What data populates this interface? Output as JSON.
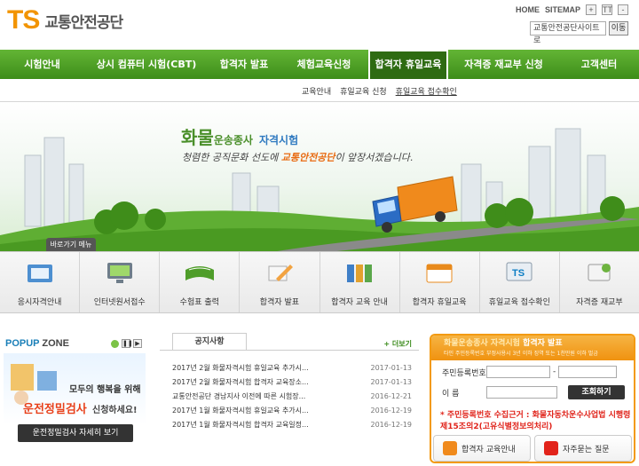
{
  "header": {
    "logo_mark": "TS",
    "logo_name": "교통안전공단",
    "links": [
      "HOME",
      "SITEMAP"
    ],
    "zoom_in": "+",
    "zoom_out": "-",
    "text_size": "TT",
    "site_select": "교통안전공단사이트로",
    "site_go": "이동"
  },
  "nav": {
    "items": [
      {
        "label": "시험안내"
      },
      {
        "label": "상시 컴퓨터 시험(CBT)"
      },
      {
        "label": "합격자 발표"
      },
      {
        "label": "체험교육신청"
      },
      {
        "label": "합격자 휴일교육",
        "active": true
      },
      {
        "label": "자격증 재교부 신청"
      },
      {
        "label": "고객센터"
      }
    ],
    "sub_items": [
      "교육안내",
      "휴일교육 신청",
      "휴일교육 접수확인"
    ]
  },
  "banner": {
    "title_big": "화물",
    "title_small": "운송종사",
    "title_tail": "자격시험",
    "sub_pre": "청렴한 공직문화 선도에",
    "sub_brand": "교통안전공단",
    "sub_post": "이 앞장서겠습니다."
  },
  "quick": {
    "tab": "바로가기 메뉴",
    "items": [
      {
        "label": "응시자격안내",
        "icon": "book-icon"
      },
      {
        "label": "인터넷원서접수",
        "icon": "computer-icon"
      },
      {
        "label": "수험표 출력",
        "icon": "open-book-icon"
      },
      {
        "label": "합격자 발표",
        "icon": "pencil-icon"
      },
      {
        "label": "합격자 교육 안내",
        "icon": "binders-icon"
      },
      {
        "label": "합격자 휴일교육",
        "icon": "calendar-icon"
      },
      {
        "label": "휴일교육 접수확인",
        "icon": "ts-monitor-icon"
      },
      {
        "label": "자격증 재교부",
        "icon": "card-icon"
      }
    ]
  },
  "popup": {
    "title_a": "POPUP",
    "title_b": "ZONE",
    "text1": "모두의 행복을 위해",
    "text2": "운전정밀검사",
    "text3": "신청하세요!",
    "button": "운전정밀검사 자세히 보기"
  },
  "notice": {
    "tab": "공지사항",
    "more": "+ 더보기",
    "rows": [
      {
        "title": "2017년 2월 화물자격시험 휴일교육 추가시...",
        "date": "2017-01-13"
      },
      {
        "title": "2017년 2월 화물자격시험 합격자 교육장소...",
        "date": "2017-01-13"
      },
      {
        "title": "교통안전공단 경남지사 이전에 따른 시험장...",
        "date": "2016-12-21"
      },
      {
        "title": "2017년 1월 화물자격시험 휴일교육 추가시...",
        "date": "2016-12-19"
      },
      {
        "title": "2017년 1월 화물자격시험 합격자 교육일정...",
        "date": "2016-12-19"
      }
    ]
  },
  "login": {
    "head_a": "화물운송종사 자격시험",
    "head_b": "합격자 발표",
    "head_sub": "타인 주민등록번호 부정사용시 3년 이하 징역 또는 1천만원 이하 벌금",
    "rrn_label": "주민등록번호",
    "name_label": "이   름",
    "submit": "조회하기",
    "note": "* 주민등록번호 수집근거 : 화물자동차운수사업법 시행령 제15조의2(고유식별정보의처리)",
    "btn1": "합격자 교육안내",
    "btn2": "자주묻는 질문"
  },
  "colors": {
    "brand_orange": "#f29400",
    "brand_blue": "#0b7dc4",
    "nav_green": "#4d9f24",
    "login_orange": "#f39a12",
    "alert_red": "#e0231a"
  }
}
